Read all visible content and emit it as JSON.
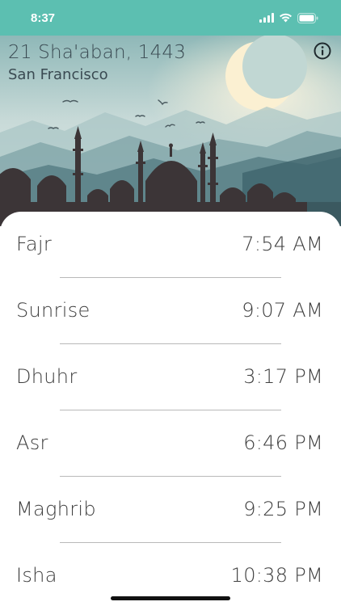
{
  "status_bar": {
    "time": "8:37",
    "icons": [
      "signal-icon",
      "wifi-icon",
      "battery-icon"
    ]
  },
  "header": {
    "hijri_date": "21 Sha'aban, 1443",
    "city": "San Francisco",
    "info_icon": "info-icon"
  },
  "prayers": [
    {
      "name": "Fajr",
      "time": "7:54 AM"
    },
    {
      "name": "Sunrise",
      "time": "9:07 AM"
    },
    {
      "name": "Dhuhr",
      "time": "3:17 PM"
    },
    {
      "name": "Asr",
      "time": "6:46 PM"
    },
    {
      "name": "Maghrib",
      "time": "9:25 PM"
    },
    {
      "name": "Isha",
      "time": "10:38 PM"
    }
  ],
  "colors": {
    "status_bar": "#5cbfb1",
    "text": "#3e3e3e",
    "divider": "#b9b9b9"
  }
}
